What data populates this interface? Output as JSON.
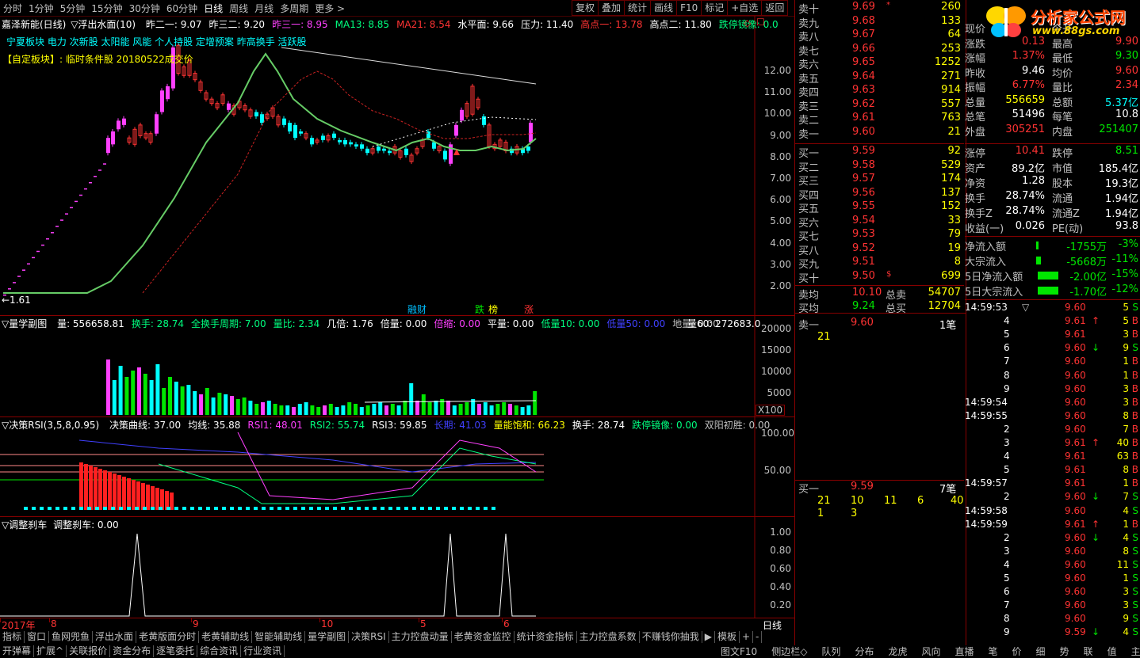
{
  "toolbar": {
    "tabs": [
      "分时",
      "1分钟",
      "5分钟",
      "15分钟",
      "30分钟",
      "60分钟",
      "日线",
      "周线",
      "月线",
      "多周期",
      "更多 >"
    ],
    "active": "日线",
    "right_buttons": [
      "复权",
      "叠加",
      "统计",
      "画线",
      "F10",
      "标记",
      "+自选",
      "返回"
    ]
  },
  "main_chart": {
    "title": "嘉泽新能(日线)",
    "indicator": "▽浮出水面(10)",
    "fields": [
      {
        "label": "昨二一: 9.07",
        "color": "#ffffff"
      },
      {
        "label": "昨三二: 9.20",
        "color": "#ffffff"
      },
      {
        "label": "昨三一: 8.95",
        "color": "#ff40ff"
      },
      {
        "label": "MA13: 8.85",
        "color": "#00ff7f"
      },
      {
        "label": "MA21: 8.54",
        "color": "#ff3333"
      },
      {
        "label": "水平面: 9.66",
        "color": "#ffffff"
      },
      {
        "label": "压力: 11.40",
        "color": "#ffffff"
      },
      {
        "label": "高点一: 13.78",
        "color": "#ff3333"
      },
      {
        "label": "高点二: 11.80",
        "color": "#ffffff"
      },
      {
        "label": "跌停镜像: 0.0",
        "color": "#00ff7f"
      }
    ],
    "sector_line": "宁夏板块 电力 次新股 太阳能 风能 个人持股 定增预案 昨高换手 活跃股",
    "custom_line": "【自定板块】: 临时条件股 20180522成交价",
    "low_marker": "←1.61",
    "ticks": [
      "12.00",
      "11.00",
      "10.00",
      "9.00",
      "8.00",
      "7.00",
      "6.00",
      "5.00",
      "4.00",
      "3.00",
      "2.00"
    ],
    "badges": [
      {
        "text": "融财",
        "color": "#00bfff"
      },
      {
        "text": "跌",
        "color": "#00e600"
      },
      {
        "text": "榜",
        "color": "#ffff00"
      },
      {
        "text": "涨",
        "color": "#ff3333"
      }
    ]
  },
  "volume_panel": {
    "title": "▽量学副图",
    "fields": [
      {
        "label": "量: 556658.81",
        "color": "#ffffff"
      },
      {
        "label": "换手: 28.74",
        "color": "#00ff7f"
      },
      {
        "label": "全换手周期: 7.00",
        "color": "#00ff7f"
      },
      {
        "label": "量比: 2.34",
        "color": "#00ff7f"
      },
      {
        "label": "几倍: 1.76",
        "color": "#ffffff"
      },
      {
        "label": "倍量: 0.00",
        "color": "#ffffff"
      },
      {
        "label": "倍缩: 0.00",
        "color": "#ff40ff"
      },
      {
        "label": "平量: 0.00",
        "color": "#ffffff"
      },
      {
        "label": "低量10: 0.00",
        "color": "#00ff7f"
      },
      {
        "label": "低量50: 0.00",
        "color": "#4040ff"
      },
      {
        "label": "地量: 0.00",
        "color": "#c0c0c0"
      }
    ],
    "right_label": "量60: 272683.0",
    "ticks": [
      "20000",
      "15000",
      "10000",
      "5000"
    ],
    "unit": "X100"
  },
  "rsi_panel": {
    "title": "▽决策RSI(3,5,8,0.95)",
    "fields": [
      {
        "label": "决策曲线: 37.00",
        "color": "#ffffff"
      },
      {
        "label": "均线: 35.88",
        "color": "#ffffff"
      },
      {
        "label": "RSI1: 48.01",
        "color": "#ff40ff"
      },
      {
        "label": "RSI2: 55.74",
        "color": "#00ff7f"
      },
      {
        "label": "RSI3: 59.85",
        "color": "#ffffff"
      },
      {
        "label": "长期: 41.03",
        "color": "#4040ff"
      },
      {
        "label": "量能饱和: 66.23",
        "color": "#ffff00"
      },
      {
        "label": "换手: 28.74",
        "color": "#ffffff"
      },
      {
        "label": "跌停镜像: 0.00",
        "color": "#00ff7f"
      },
      {
        "label": "双阳初胜: 0.00",
        "color": "#c0c0c0"
      }
    ],
    "ticks": [
      "100.00",
      "50.00"
    ]
  },
  "brake_panel": {
    "title": "▽调整刹车",
    "field": "调整刹车: 0.00",
    "ticks": [
      "1.00",
      "0.80",
      "0.60",
      "0.40",
      "0.20"
    ]
  },
  "time_axis": {
    "labels": [
      "2017年",
      "8",
      "9",
      "10",
      "5",
      "6"
    ],
    "period": "日线"
  },
  "bottom_tabs": [
    "指标",
    "窗口",
    "鱼网兜鱼",
    "浮出水面",
    "老黄版面分时",
    "老黄辅助线",
    "智能辅助线",
    "量学副图",
    "决策RSI",
    "主力控盘动量",
    "老黄资金监控",
    "统计资金指标",
    "主力控盘系数",
    "不赚钱你抽我",
    "▶",
    "模板",
    "+",
    "-"
  ],
  "status_tabs": [
    "开弹幕",
    "扩展^",
    "关联报价",
    "资金分布",
    "逐笔委托",
    "综合资讯",
    "行业资讯"
  ],
  "right_status": [
    "图文F10",
    "侧边栏◇",
    "队列",
    "分布",
    "龙虎",
    "风向",
    "直播",
    "笔",
    "价",
    "细",
    "势",
    "联",
    "值",
    "主"
  ],
  "order_book": {
    "sells": [
      {
        "n": "卖十",
        "p": "9.69",
        "v": "260",
        "mark": "*"
      },
      {
        "n": "卖九",
        "p": "9.68",
        "v": "133"
      },
      {
        "n": "卖八",
        "p": "9.67",
        "v": "64"
      },
      {
        "n": "卖七",
        "p": "9.66",
        "v": "253"
      },
      {
        "n": "卖六",
        "p": "9.65",
        "v": "1252"
      },
      {
        "n": "卖五",
        "p": "9.64",
        "v": "271"
      },
      {
        "n": "卖四",
        "p": "9.63",
        "v": "914"
      },
      {
        "n": "卖三",
        "p": "9.62",
        "v": "557"
      },
      {
        "n": "卖二",
        "p": "9.61",
        "v": "763"
      },
      {
        "n": "卖一",
        "p": "9.60",
        "v": "21"
      }
    ],
    "buys": [
      {
        "n": "买一",
        "p": "9.59",
        "v": "92"
      },
      {
        "n": "买二",
        "p": "9.58",
        "v": "529"
      },
      {
        "n": "买三",
        "p": "9.57",
        "v": "174"
      },
      {
        "n": "买四",
        "p": "9.56",
        "v": "137"
      },
      {
        "n": "买五",
        "p": "9.55",
        "v": "152"
      },
      {
        "n": "买六",
        "p": "9.54",
        "v": "33"
      },
      {
        "n": "买七",
        "p": "9.53",
        "v": "79"
      },
      {
        "n": "买八",
        "p": "9.52",
        "v": "19"
      },
      {
        "n": "买九",
        "p": "9.51",
        "v": "8"
      },
      {
        "n": "买十",
        "p": "9.50",
        "v": "699",
        "mark": "$"
      }
    ],
    "avg": [
      {
        "n": "卖均",
        "p": "10.10",
        "l": "总卖",
        "v": "54707"
      },
      {
        "n": "买均",
        "p": "9.24",
        "l": "总买",
        "v": "12704"
      }
    ]
  },
  "queue": {
    "sell_row": {
      "label": "卖一",
      "price": "9.60",
      "count": "1笔",
      "items": [
        "21"
      ]
    },
    "buy_row": {
      "label": "买一",
      "price": "9.59",
      "count": "7笔",
      "items": [
        "21",
        "10",
        "11",
        "6",
        "40",
        "1",
        "3"
      ]
    }
  },
  "stats": [
    {
      "a": "现价",
      "av": "",
      "b": "今开",
      "bv": ""
    },
    {
      "a": "涨跌",
      "av": "0.13",
      "b": "最高",
      "bv": "9.90"
    },
    {
      "a": "涨幅",
      "av": "1.37%",
      "b": "最低",
      "bv": "9.30"
    },
    {
      "a": "昨收",
      "av": "9.46",
      "b": "均价",
      "bv": "9.60"
    },
    {
      "a": "振幅",
      "av": "6.77%",
      "b": "量比",
      "bv": "2.34"
    },
    {
      "a": "总量",
      "av": "556659",
      "b": "总额",
      "bv": "5.37亿"
    },
    {
      "a": "总笔",
      "av": "51496",
      "b": "每笔",
      "bv": "10.8"
    },
    {
      "a": "外盘",
      "av": "305251",
      "b": "内盘",
      "bv": "251407"
    },
    {
      "a": "涨停",
      "av": "10.41",
      "b": "跌停",
      "bv": "8.51"
    },
    {
      "a": "资产",
      "av": "89.2亿",
      "b": "市值",
      "bv": "185.4亿"
    },
    {
      "a": "净资",
      "av": "1.28",
      "b": "股本",
      "bv": "19.3亿"
    },
    {
      "a": "换手",
      "av": "28.74%",
      "b": "流通",
      "bv": "1.94亿"
    },
    {
      "a": "换手Z",
      "av": "28.74%",
      "b": "流通Z",
      "bv": "1.94亿"
    },
    {
      "a": "收益(一)",
      "av": "0.026",
      "b": "PE(动)",
      "bv": "93.8"
    }
  ],
  "flows": [
    {
      "label": "净流入额",
      "v": "-1755万",
      "p": "-3%"
    },
    {
      "label": "大宗流入",
      "v": "-5668万",
      "p": "-11%"
    },
    {
      "label": "5日净流入额",
      "v": "-2.00亿",
      "p": "-15%"
    },
    {
      "label": "5日大宗流入",
      "v": "-1.70亿",
      "p": "-12%"
    }
  ],
  "ticks_list": [
    {
      "t": "14:59:53",
      "m": "▽",
      "p": "9.60",
      "a": "",
      "v": "5",
      "s": "S"
    },
    {
      "t": "4",
      "m": "",
      "p": "9.61",
      "a": "↑",
      "v": "5",
      "s": "B"
    },
    {
      "t": "5",
      "m": "",
      "p": "9.61",
      "a": "",
      "v": "3",
      "s": "B"
    },
    {
      "t": "6",
      "m": "",
      "p": "9.60",
      "a": "↓",
      "v": "9",
      "s": "S"
    },
    {
      "t": "7",
      "m": "",
      "p": "9.60",
      "a": "",
      "v": "1",
      "s": "B"
    },
    {
      "t": "8",
      "m": "",
      "p": "9.60",
      "a": "",
      "v": "1",
      "s": "B"
    },
    {
      "t": "9",
      "m": "",
      "p": "9.60",
      "a": "",
      "v": "3",
      "s": "B"
    },
    {
      "t": "14:59:54",
      "m": "",
      "p": "9.60",
      "a": "",
      "v": "3",
      "s": "B"
    },
    {
      "t": "14:59:55",
      "m": "",
      "p": "9.60",
      "a": "",
      "v": "8",
      "s": "B"
    },
    {
      "t": "2",
      "m": "",
      "p": "9.60",
      "a": "",
      "v": "7",
      "s": "B"
    },
    {
      "t": "3",
      "m": "",
      "p": "9.61",
      "a": "↑",
      "v": "40",
      "s": "B"
    },
    {
      "t": "4",
      "m": "",
      "p": "9.61",
      "a": "",
      "v": "63",
      "s": "B"
    },
    {
      "t": "5",
      "m": "",
      "p": "9.61",
      "a": "",
      "v": "8",
      "s": "B"
    },
    {
      "t": "14:59:57",
      "m": "",
      "p": "9.61",
      "a": "",
      "v": "1",
      "s": "B"
    },
    {
      "t": "2",
      "m": "",
      "p": "9.60",
      "a": "↓",
      "v": "7",
      "s": "S"
    },
    {
      "t": "14:59:58",
      "m": "",
      "p": "9.60",
      "a": "",
      "v": "4",
      "s": "S"
    },
    {
      "t": "14:59:59",
      "m": "",
      "p": "9.61",
      "a": "↑",
      "v": "1",
      "s": "B"
    },
    {
      "t": "2",
      "m": "",
      "p": "9.60",
      "a": "↓",
      "v": "4",
      "s": "S"
    },
    {
      "t": "3",
      "m": "",
      "p": "9.60",
      "a": "",
      "v": "8",
      "s": "S"
    },
    {
      "t": "4",
      "m": "",
      "p": "9.60",
      "a": "",
      "v": "11",
      "s": "S"
    },
    {
      "t": "5",
      "m": "",
      "p": "9.60",
      "a": "",
      "v": "1",
      "s": "S"
    },
    {
      "t": "6",
      "m": "",
      "p": "9.60",
      "a": "",
      "v": "3",
      "s": "S"
    },
    {
      "t": "7",
      "m": "",
      "p": "9.60",
      "a": "",
      "v": "3",
      "s": "S"
    },
    {
      "t": "8",
      "m": "",
      "p": "9.60",
      "a": "",
      "v": "9",
      "s": "S"
    },
    {
      "t": "9",
      "m": "",
      "p": "9.59",
      "a": "↓",
      "v": "4",
      "s": "S"
    }
  ],
  "logo": {
    "title": "分析家公式网",
    "url": "www.88gs.com"
  }
}
